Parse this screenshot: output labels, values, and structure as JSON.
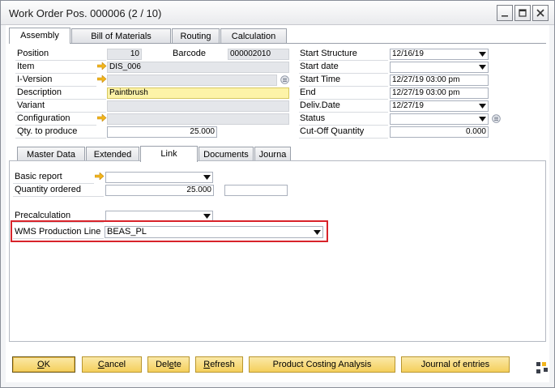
{
  "window": {
    "title": "Work Order Pos. 000006 (2 / 10)",
    "controls": {
      "minimize": "minimize-icon",
      "maximize": "maximize-icon",
      "close": "close-icon"
    }
  },
  "tabs": [
    {
      "label": "Assembly",
      "active": true
    },
    {
      "label": "Bill of Materials",
      "active": false
    },
    {
      "label": "Routing",
      "active": false
    },
    {
      "label": "Calculation",
      "active": false
    }
  ],
  "left_fields": {
    "position": {
      "label": "Position",
      "value": "10"
    },
    "barcode": {
      "label": "Barcode",
      "value": "000002010"
    },
    "item": {
      "label": "Item",
      "value": "DIS_006"
    },
    "i_version": {
      "label": "I-Version",
      "value": ""
    },
    "description": {
      "label": "Description",
      "value": "Paintbrush"
    },
    "variant": {
      "label": "Variant",
      "value": ""
    },
    "configuration": {
      "label": "Configuration",
      "value": ""
    },
    "qty_to_produce": {
      "label": "Qty. to produce",
      "value": "25.000"
    }
  },
  "right_fields": {
    "start_structure": {
      "label": "Start Structure",
      "value": "12/16/19"
    },
    "start_date": {
      "label": "Start date",
      "value": ""
    },
    "start_time": {
      "label": "Start Time",
      "value": "12/27/19 03:00 pm"
    },
    "end": {
      "label": "End",
      "value": "12/27/19 03:00 pm"
    },
    "deliv_date": {
      "label": "Deliv.Date",
      "value": "12/27/19"
    },
    "status": {
      "label": "Status",
      "value": ""
    },
    "cutoff_quantity": {
      "label": "Cut-Off Quantity",
      "value": "0.000"
    }
  },
  "subtabs": [
    {
      "label": "Master Data",
      "active": false
    },
    {
      "label": "Extended",
      "active": false
    },
    {
      "label": "Link",
      "active": true
    },
    {
      "label": "Documents",
      "active": false
    },
    {
      "label": "Journa",
      "active": false
    }
  ],
  "link": {
    "basic_report": {
      "label": "Basic report",
      "value": ""
    },
    "quantity_ordered": {
      "label": "Quantity ordered",
      "value": "25.000",
      "extra": ""
    },
    "precalculation": {
      "label": "Precalculation",
      "value": ""
    },
    "wms_production_line": {
      "label": "WMS Production Line",
      "value": "BEAS_PL"
    }
  },
  "buttons": {
    "ok": {
      "underlined": "O",
      "rest": "K"
    },
    "cancel": {
      "underlined": "C",
      "rest": "ancel"
    },
    "delete": {
      "before": "Del",
      "underlined": "e",
      "rest": "te"
    },
    "refresh": {
      "underlined": "R",
      "rest": "efresh"
    },
    "product_costing": "Product Costing Analysis",
    "journal": "Journal of entries"
  },
  "colors": {
    "highlight": "#d8232a",
    "button_gold": "#f4cf5c",
    "mandatory_yellow": "#fdf3a8",
    "link_arrow": "#f2b51d"
  }
}
